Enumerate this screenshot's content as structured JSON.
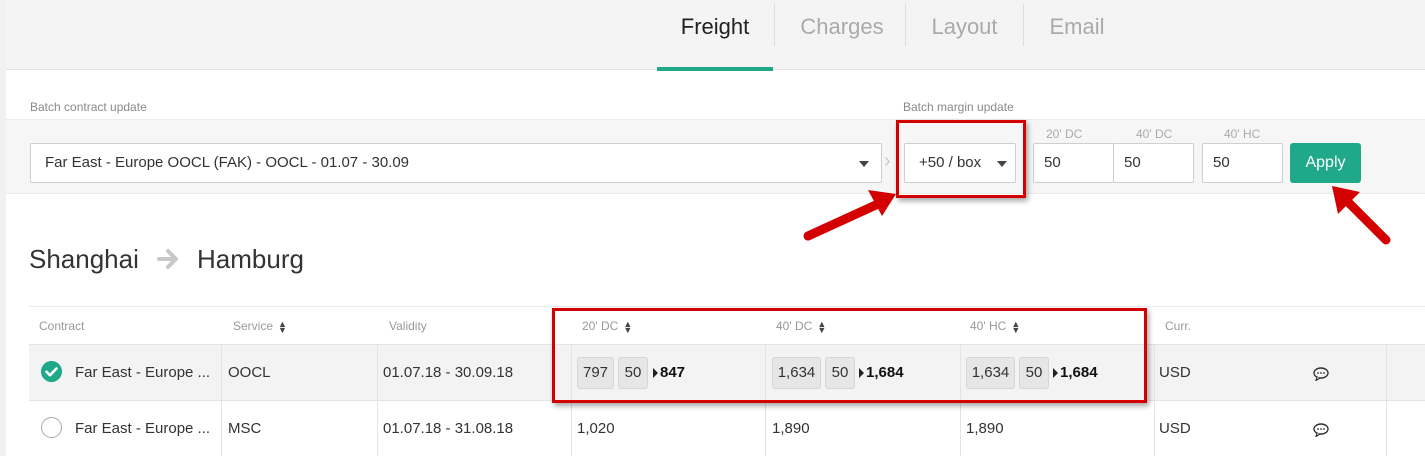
{
  "tabs": [
    {
      "label": "Freight",
      "active": true
    },
    {
      "label": "Charges",
      "active": false
    },
    {
      "label": "Layout",
      "active": false
    },
    {
      "label": "Email",
      "active": false
    }
  ],
  "batch": {
    "contract_label": "Batch contract update",
    "contract_value": "Far East - Europe OOCL (FAK) - OOCL - 01.07 - 30.09",
    "margin_label": "Batch margin update",
    "margin_value": "+50 / box",
    "columns": [
      "20' DC",
      "40' DC",
      "40' HC"
    ],
    "values": [
      "50",
      "50",
      "50"
    ],
    "apply_label": "Apply"
  },
  "route": {
    "origin": "Shanghai",
    "destination": "Hamburg"
  },
  "table": {
    "headers": {
      "contract": "Contract",
      "service": "Service",
      "validity": "Validity",
      "dc20": "20' DC",
      "dc40": "40' DC",
      "hc40": "40' HC",
      "curr": "Curr."
    },
    "rows": [
      {
        "selected": true,
        "contract": "Far East - Europe ...",
        "service": "OOCL",
        "validity": "01.07.18 - 30.09.18",
        "dc20": {
          "base": "797",
          "margin": "50",
          "total": "847"
        },
        "dc40": {
          "base": "1,634",
          "margin": "50",
          "total": "1,684"
        },
        "hc40": {
          "base": "1,634",
          "margin": "50",
          "total": "1,684"
        },
        "curr": "USD"
      },
      {
        "selected": false,
        "contract": "Far East - Europe ...",
        "service": "MSC",
        "validity": "01.07.18 - 31.08.18",
        "dc20": "1,020",
        "dc40": "1,890",
        "hc40": "1,890",
        "curr": "USD"
      }
    ]
  },
  "colors": {
    "accent": "#1fa98a",
    "annotation": "#d40000"
  }
}
